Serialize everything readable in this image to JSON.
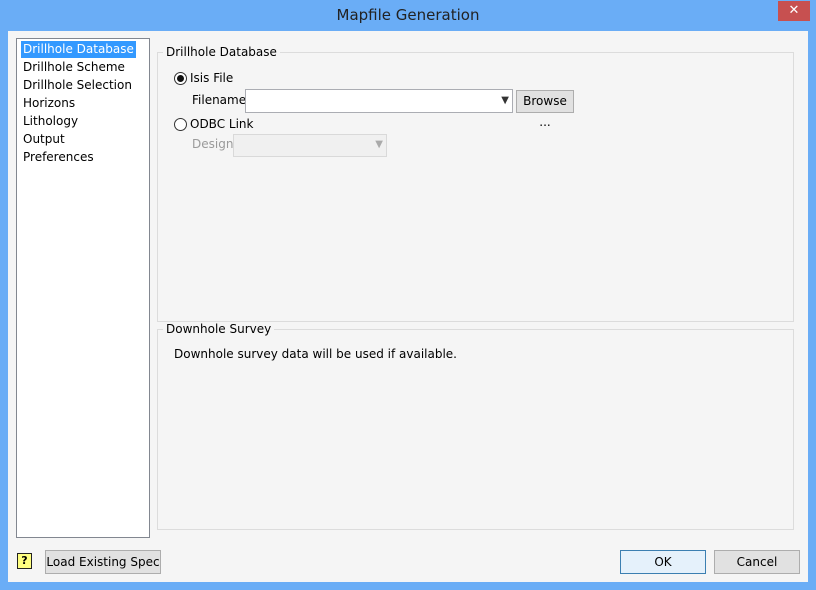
{
  "window": {
    "title": "Mapfile Generation",
    "close_icon": "close-icon"
  },
  "nav": {
    "items": [
      {
        "label": "Drillhole Database",
        "selected": true
      },
      {
        "label": "Drillhole Scheme"
      },
      {
        "label": "Drillhole Selection"
      },
      {
        "label": "Horizons"
      },
      {
        "label": "Lithology"
      },
      {
        "label": "Output"
      },
      {
        "label": "Preferences"
      }
    ]
  },
  "database": {
    "group_label": "Drillhole Database",
    "isis_label": "Isis File",
    "isis_selected": true,
    "filename_label": "Filename",
    "filename_value": "",
    "browse_label": "Browse ...",
    "odbc_label": "ODBC Link",
    "odbc_selected": false,
    "design_label": "Design",
    "design_value": ""
  },
  "survey": {
    "group_label": "Downhole Survey",
    "message": "Downhole survey data will be used if available."
  },
  "footer": {
    "load_label": "Load Existing Spec",
    "ok_label": "OK",
    "cancel_label": "Cancel"
  }
}
